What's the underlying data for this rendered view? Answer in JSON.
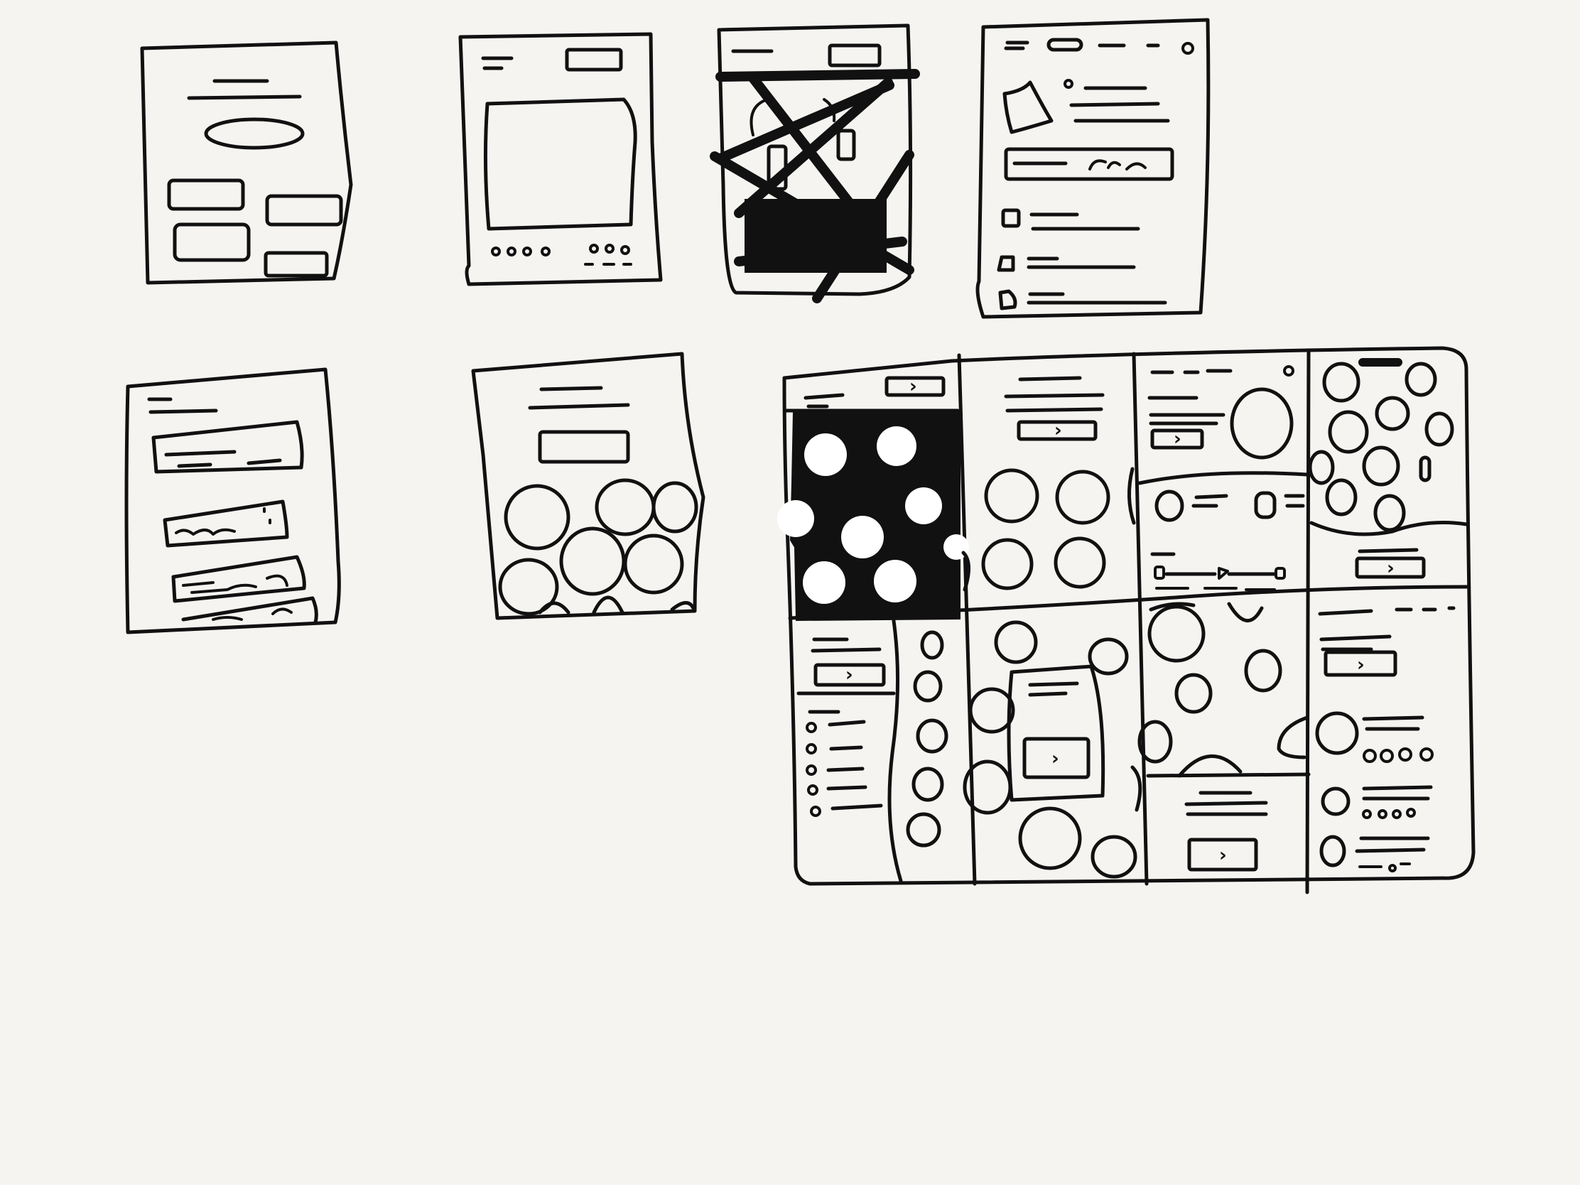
{
  "canvas": {
    "background": "#f5f4f0",
    "ink": "#111111"
  },
  "sketches": [
    {
      "id": "landing",
      "description_hidden": true
    },
    {
      "id": "media"
    },
    {
      "id": "map-crossed"
    },
    {
      "id": "profile"
    },
    {
      "id": "list-cards"
    },
    {
      "id": "avatar-grid"
    },
    {
      "id": "tablet-layout"
    }
  ],
  "icons": {
    "next": "chevron-right-icon"
  }
}
